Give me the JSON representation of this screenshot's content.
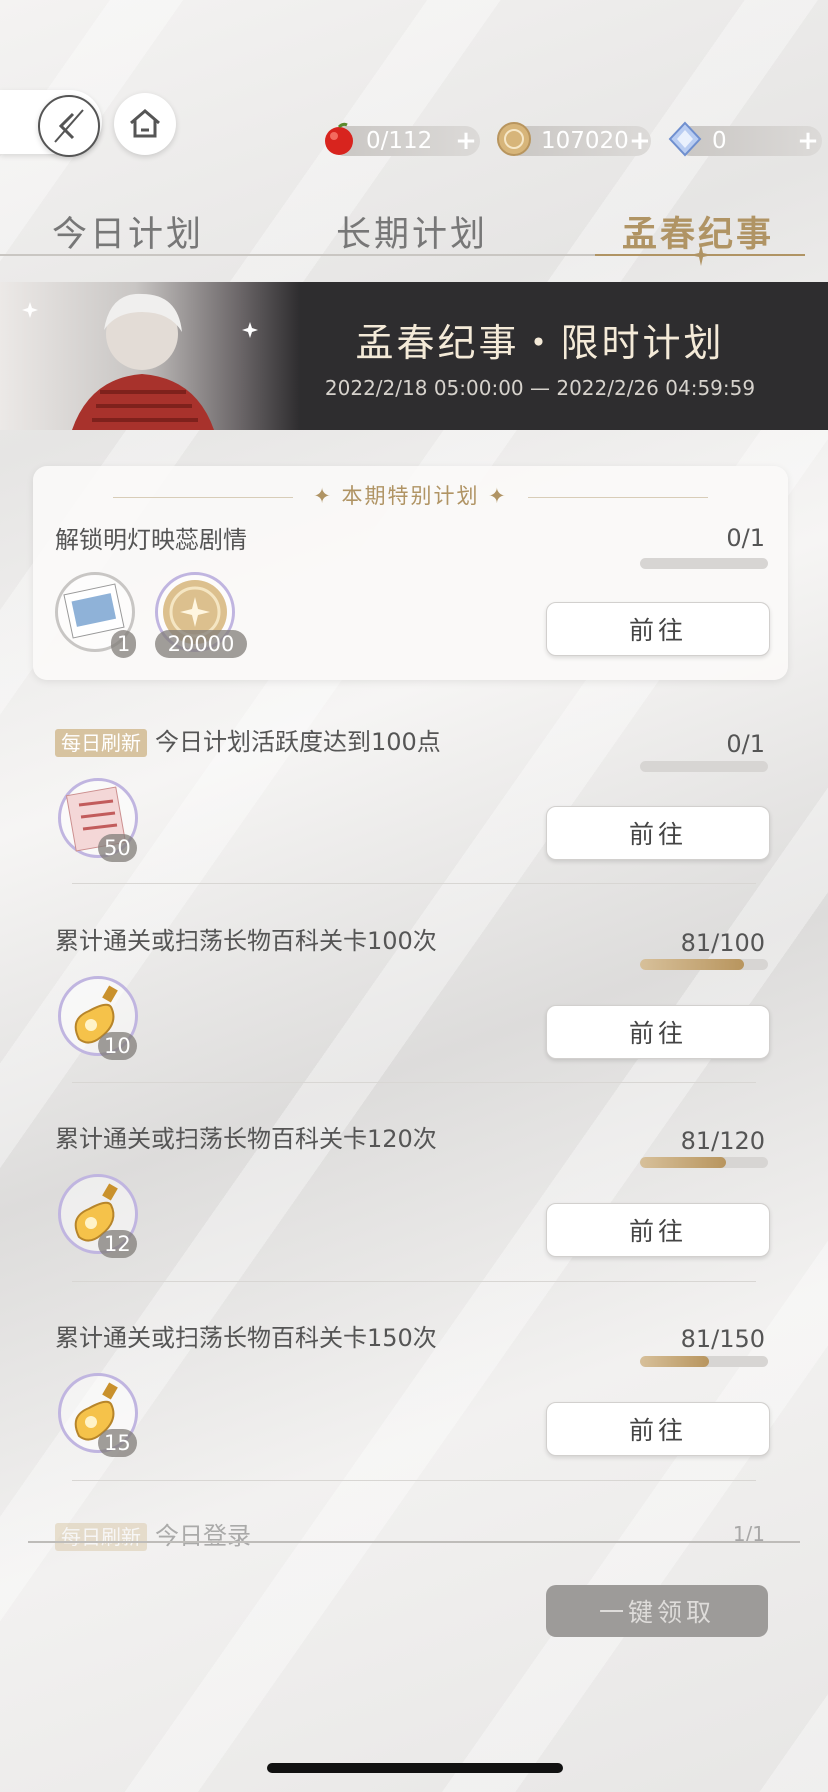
{
  "resources": [
    {
      "icon": "apple-icon",
      "value": "0/112"
    },
    {
      "icon": "coin-icon",
      "value": "107020"
    },
    {
      "icon": "diamond-icon",
      "value": "0"
    }
  ],
  "tabs": [
    "今日计划",
    "长期计划",
    "孟春纪事"
  ],
  "active_tab": 2,
  "banner": {
    "title": "孟春纪事・限时计划",
    "dates": "2022/2/18 05:00:00 — 2022/2/26 04:59:59"
  },
  "special": {
    "header": "本期特别计划",
    "task": {
      "title": "解锁明灯映蕊剧情",
      "count": "0/1",
      "progress": 0,
      "rewards": [
        {
          "icon": "friend-circle-card-icon",
          "qty": "1"
        },
        {
          "icon": "gold-coin-icon",
          "qty": "20000"
        }
      ],
      "button": "前往"
    }
  },
  "tasks": [
    {
      "badge": "每日刷新",
      "title": "今日计划活跃度达到100点",
      "count": "0/1",
      "progress": 0,
      "reward": {
        "icon": "schedule-card-icon",
        "qty": "50"
      },
      "button": "前往"
    },
    {
      "badge": "",
      "title": "累计通关或扫荡长物百科关卡100次",
      "count": "81/100",
      "progress": 0.81,
      "reward": {
        "icon": "potion-bottle-icon",
        "qty": "10"
      },
      "button": "前往"
    },
    {
      "badge": "",
      "title": "累计通关或扫荡长物百科关卡120次",
      "count": "81/120",
      "progress": 0.675,
      "reward": {
        "icon": "potion-bottle-icon",
        "qty": "12"
      },
      "button": "前往"
    },
    {
      "badge": "",
      "title": "累计通关或扫荡长物百科关卡150次",
      "count": "81/150",
      "progress": 0.54,
      "reward": {
        "icon": "potion-bottle-icon",
        "qty": "15"
      },
      "button": "前往"
    }
  ],
  "partial_task": {
    "badge": "每日刷新",
    "title": "今日登录",
    "count": "1/1"
  },
  "claim_all": "一键领取"
}
